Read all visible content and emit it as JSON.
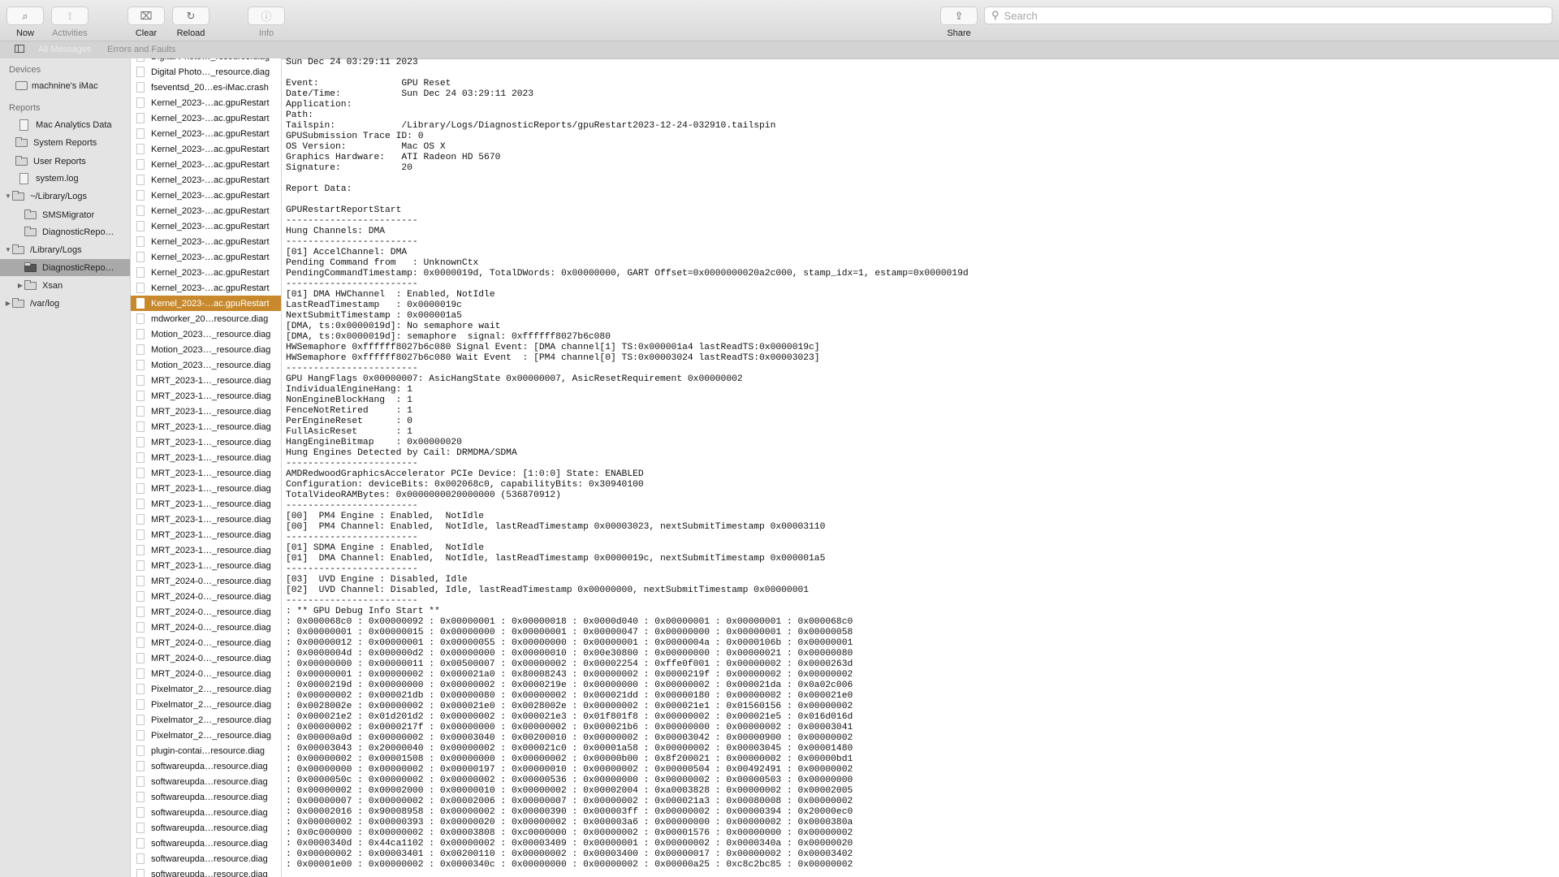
{
  "toolbar": {
    "buttons": [
      {
        "label": "Now",
        "icon": "magnifier-arrow-icon",
        "glyph": "⌕"
      },
      {
        "label": "Activities",
        "icon": "activities-icon",
        "glyph": "⟟"
      },
      {
        "label": "Clear",
        "icon": "clear-icon",
        "glyph": "⌧"
      },
      {
        "label": "Reload",
        "icon": "reload-icon",
        "glyph": "↻"
      },
      {
        "label": "Info",
        "icon": "info-icon",
        "glyph": "ⓘ"
      }
    ],
    "share_label": "Share",
    "share_glyph": "⇪",
    "search_placeholder": "Search"
  },
  "filterbar": {
    "all_messages": "All Messages",
    "errors_and_faults": "Errors and Faults"
  },
  "sidebar": {
    "devices_header": "Devices",
    "device": "machnine's iMac",
    "reports_header": "Reports",
    "items": [
      {
        "label": "Mac Analytics Data",
        "type": "doc",
        "indent": 0
      },
      {
        "label": "System Reports",
        "type": "folder",
        "indent": 0
      },
      {
        "label": "User Reports",
        "type": "folder",
        "indent": 0
      },
      {
        "label": "system.log",
        "type": "doc",
        "indent": 0
      },
      {
        "label": "~/Library/Logs",
        "type": "folder",
        "indent": 0,
        "disclosure": "expanded"
      },
      {
        "label": "SMSMigrator",
        "type": "folder",
        "indent": 1
      },
      {
        "label": "DiagnosticRepo…",
        "type": "folder",
        "indent": 1
      },
      {
        "label": "/Library/Logs",
        "type": "folder",
        "indent": 0,
        "disclosure": "expanded"
      },
      {
        "label": "DiagnosticRepo…",
        "type": "folder",
        "indent": 1,
        "selected": true
      },
      {
        "label": "Xsan",
        "type": "folder",
        "indent": 1,
        "disclosure": "collapsed"
      },
      {
        "label": "/var/log",
        "type": "folder",
        "indent": 0,
        "disclosure": "collapsed"
      }
    ]
  },
  "files": [
    "Digital Photo…_resource.diag",
    "Digital Photo…_resource.diag",
    "fseventsd_20…es-iMac.crash",
    "Kernel_2023-…ac.gpuRestart",
    "Kernel_2023-…ac.gpuRestart",
    "Kernel_2023-…ac.gpuRestart",
    "Kernel_2023-…ac.gpuRestart",
    "Kernel_2023-…ac.gpuRestart",
    "Kernel_2023-…ac.gpuRestart",
    "Kernel_2023-…ac.gpuRestart",
    "Kernel_2023-…ac.gpuRestart",
    "Kernel_2023-…ac.gpuRestart",
    "Kernel_2023-…ac.gpuRestart",
    "Kernel_2023-…ac.gpuRestart",
    "Kernel_2023-…ac.gpuRestart",
    "Kernel_2023-…ac.gpuRestart",
    "Kernel_2023-…ac.gpuRestart",
    "mdworker_20…resource.diag",
    "Motion_2023…_resource.diag",
    "Motion_2023…_resource.diag",
    "Motion_2023…_resource.diag",
    "MRT_2023-1…_resource.diag",
    "MRT_2023-1…_resource.diag",
    "MRT_2023-1…_resource.diag",
    "MRT_2023-1…_resource.diag",
    "MRT_2023-1…_resource.diag",
    "MRT_2023-1…_resource.diag",
    "MRT_2023-1…_resource.diag",
    "MRT_2023-1…_resource.diag",
    "MRT_2023-1…_resource.diag",
    "MRT_2023-1…_resource.diag",
    "MRT_2023-1…_resource.diag",
    "MRT_2023-1…_resource.diag",
    "MRT_2023-1…_resource.diag",
    "MRT_2024-0…_resource.diag",
    "MRT_2024-0…_resource.diag",
    "MRT_2024-0…_resource.diag",
    "MRT_2024-0…_resource.diag",
    "MRT_2024-0…_resource.diag",
    "MRT_2024-0…_resource.diag",
    "MRT_2024-0…_resource.diag",
    "Pixelmator_2…_resource.diag",
    "Pixelmator_2…_resource.diag",
    "Pixelmator_2…_resource.diag",
    "Pixelmator_2…_resource.diag",
    "plugin-contai…resource.diag",
    "softwareupda…resource.diag",
    "softwareupda…resource.diag",
    "softwareupda…resource.diag",
    "softwareupda…resource.diag",
    "softwareupda…resource.diag",
    "softwareupda…resource.diag",
    "softwareupda…resource.diag",
    "softwareupda…resource.diag"
  ],
  "selected_file_index": 16,
  "colors": {
    "selection": "#c8892d",
    "sidebar_selection": "#a9a9a9"
  },
  "log_lines": [
    "Sun Dec 24 03:29:11 2023",
    "",
    "Event:               GPU Reset",
    "Date/Time:           Sun Dec 24 03:29:11 2023",
    "Application:",
    "Path:",
    "Tailspin:            /Library/Logs/DiagnosticReports/gpuRestart2023-12-24-032910.tailspin",
    "GPUSubmission Trace ID: 0",
    "OS Version:          Mac OS X",
    "Graphics Hardware:   ATI Radeon HD 5670",
    "Signature:           20",
    "",
    "Report Data:",
    "",
    "GPURestartReportStart",
    "------------------------",
    "Hung Channels: DMA",
    "------------------------",
    "[01] AccelChannel: DMA",
    "Pending Command from   : UnknownCtx",
    "PendingCommandTimestamp: 0x0000019d, TotalDWords: 0x00000000, GART Offset=0x0000000020a2c000, stamp_idx=1, estamp=0x0000019d",
    "------------------------",
    "[01] DMA HWChannel  : Enabled, NotIdle",
    "LastReadTimestamp   : 0x0000019c",
    "NextSubmitTimestamp : 0x000001a5",
    "[DMA, ts:0x0000019d]: No semaphore wait",
    "[DMA, ts:0x0000019d]: semaphore  signal: 0xffffff8027b6c080",
    "HWSemaphore 0xffffff8027b6c080 Signal Event: [DMA channel[1] TS:0x000001a4 lastReadTS:0x0000019c]",
    "HWSemaphore 0xffffff8027b6c080 Wait Event  : [PM4 channel[0] TS:0x00003024 lastReadTS:0x00003023]",
    "------------------------",
    "GPU HangFlags 0x00000007: AsicHangState 0x00000007, AsicResetRequirement 0x00000002",
    "IndividualEngineHang: 1",
    "NonEngineBlockHang  : 1",
    "FenceNotRetired     : 1",
    "PerEngineReset      : 0",
    "FullAsicReset       : 1",
    "HangEngineBitmap    : 0x00000020",
    "Hung Engines Detected by Cail: DRMDMA/SDMA",
    "------------------------",
    "AMDRedwoodGraphicsAccelerator PCIe Device: [1:0:0] State: ENABLED",
    "Configuration: deviceBits: 0x002068c0, capabilityBits: 0x30940100",
    "TotalVideoRAMBytes: 0x0000000020000000 (536870912)",
    "------------------------",
    "[00]  PM4 Engine : Enabled,  NotIdle",
    "[00]  PM4 Channel: Enabled,  NotIdle, lastReadTimestamp 0x00003023, nextSubmitTimestamp 0x00003110",
    "------------------------",
    "[01] SDMA Engine : Enabled,  NotIdle",
    "[01]  DMA Channel: Enabled,  NotIdle, lastReadTimestamp 0x0000019c, nextSubmitTimestamp 0x000001a5",
    "------------------------",
    "[03]  UVD Engine : Disabled, Idle",
    "[02]  UVD Channel: Disabled, Idle, lastReadTimestamp 0x00000000, nextSubmitTimestamp 0x00000001",
    "------------------------",
    ": ** GPU Debug Info Start **",
    ": 0x000068c0 : 0x00000092 : 0x00000001 : 0x00000018 : 0x0000d040 : 0x00000001 : 0x00000001 : 0x000068c0",
    ": 0x00000001 : 0x00000015 : 0x00000000 : 0x00000001 : 0x00000047 : 0x00000000 : 0x00000001 : 0x00000058",
    ": 0x00000012 : 0x00000001 : 0x00000055 : 0x00000000 : 0x00000001 : 0x0000004a : 0x0000106b : 0x00000001",
    ": 0x0000004d : 0x000000d2 : 0x00000000 : 0x00000010 : 0x00e30800 : 0x00000000 : 0x00000021 : 0x00000080",
    ": 0x00000000 : 0x00000011 : 0x00500007 : 0x00000002 : 0x00002254 : 0xffe0f001 : 0x00000002 : 0x0000263d",
    ": 0x00000001 : 0x00000002 : 0x000021a0 : 0x80008243 : 0x00000002 : 0x0000219f : 0x00000002 : 0x00000002",
    ": 0x0000219d : 0x00000000 : 0x00000002 : 0x0000219e : 0x00000000 : 0x00000002 : 0x000021da : 0x0a02c006",
    ": 0x00000002 : 0x000021db : 0x00000080 : 0x00000002 : 0x000021dd : 0x00000180 : 0x00000002 : 0x000021e0",
    ": 0x0028002e : 0x00000002 : 0x000021e0 : 0x0028002e : 0x00000002 : 0x000021e1 : 0x01560156 : 0x00000002",
    ": 0x000021e2 : 0x01d201d2 : 0x00000002 : 0x000021e3 : 0x01f801f8 : 0x00000002 : 0x000021e5 : 0x016d016d",
    ": 0x00000002 : 0x0000217f : 0x00000000 : 0x00000002 : 0x000021b6 : 0x00000000 : 0x00000002 : 0x00003041",
    ": 0x00000a0d : 0x00000002 : 0x00003040 : 0x00200010 : 0x00000002 : 0x00003042 : 0x00000900 : 0x00000002",
    ": 0x00003043 : 0x20000040 : 0x00000002 : 0x000021c0 : 0x00001a58 : 0x00000002 : 0x00003045 : 0x00001480",
    ": 0x00000002 : 0x00001508 : 0x00000000 : 0x00000002 : 0x00000b00 : 0x8f200021 : 0x00000002 : 0x00000bd1",
    ": 0x00000000 : 0x00000002 : 0x00000197 : 0x00000010 : 0x00000002 : 0x00000504 : 0x00492491 : 0x00000002",
    ": 0x0000050c : 0x00000002 : 0x00000002 : 0x00000536 : 0x00000000 : 0x00000002 : 0x00000503 : 0x00000000",
    ": 0x00000002 : 0x00002000 : 0x00000010 : 0x00000002 : 0x00002004 : 0xa0003828 : 0x00000002 : 0x00002005",
    ": 0x00000007 : 0x00000002 : 0x00002006 : 0x00000007 : 0x00000002 : 0x000021a3 : 0x00080008 : 0x00000002",
    ": 0x00002016 : 0x90008958 : 0x00000002 : 0x00000390 : 0x000003ff : 0x00000002 : 0x00000394 : 0x20000ec0",
    ": 0x00000002 : 0x00000393 : 0x00000020 : 0x00000002 : 0x000003a6 : 0x00000000 : 0x00000002 : 0x0000380a",
    ": 0x0c000000 : 0x00000002 : 0x00003808 : 0xc0000000 : 0x00000002 : 0x00001576 : 0x00000000 : 0x00000002",
    ": 0x0000340d : 0x44ca1102 : 0x00000002 : 0x00003409 : 0x00000001 : 0x00000002 : 0x0000340a : 0x00000020",
    ": 0x00000002 : 0x00003401 : 0x00200110 : 0x00000002 : 0x00003400 : 0x00000017 : 0x00000002 : 0x00003402",
    ": 0x00001e00 : 0x00000002 : 0x0000340c : 0x00000000 : 0x00000002 : 0x00000a25 : 0xc8c2bc85 : 0x00000002"
  ]
}
